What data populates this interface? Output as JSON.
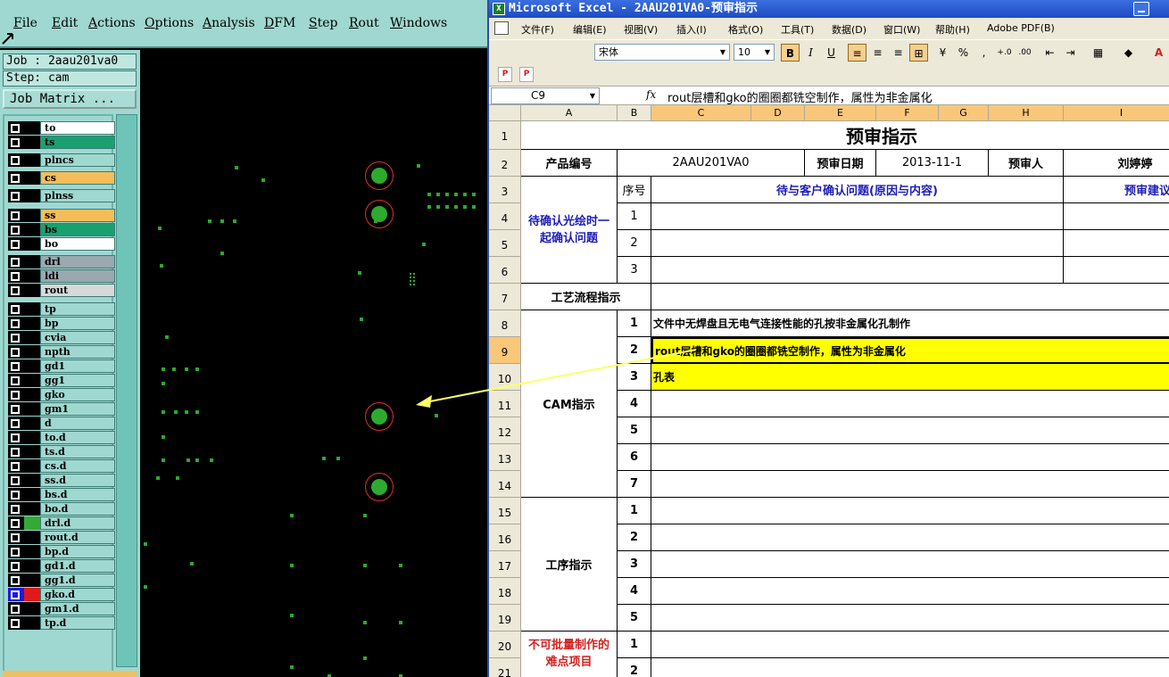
{
  "cam": {
    "menu": [
      "File",
      "Edit",
      "Actions",
      "Options",
      "Analysis",
      "DFM",
      "Step",
      "Rout",
      "Windows"
    ],
    "job_line": "Job : 2aau201va0",
    "step_line": "Step: cam",
    "job_matrix_label": "Job Matrix ...",
    "layers": [
      {
        "name": "to",
        "color": "#ffffff"
      },
      {
        "name": "ts",
        "color": "#1aa06e"
      },
      {
        "name": "plncs",
        "color": "#9fd8d0"
      },
      {
        "name": "cs",
        "color": "#f5bd5a"
      },
      {
        "name": "plnss",
        "color": "#9fd8d0"
      },
      {
        "name": "ss",
        "color": "#f5bd5a"
      },
      {
        "name": "bs",
        "color": "#1aa06e"
      },
      {
        "name": "bo",
        "color": "#ffffff"
      },
      {
        "name": "drl",
        "color": "#9aa8b0"
      },
      {
        "name": "ldi",
        "color": "#9aa8b0"
      },
      {
        "name": "rout",
        "color": "#d8d8d8"
      },
      {
        "name": "tp",
        "color": "#9fd8d0"
      },
      {
        "name": "bp",
        "color": "#9fd8d0"
      },
      {
        "name": "cvia",
        "color": "#9fd8d0"
      },
      {
        "name": "npth",
        "color": "#9fd8d0"
      },
      {
        "name": "gd1",
        "color": "#9fd8d0"
      },
      {
        "name": "gg1",
        "color": "#9fd8d0"
      },
      {
        "name": "gko",
        "color": "#9fd8d0"
      },
      {
        "name": "gm1",
        "color": "#9fd8d0"
      },
      {
        "name": "d",
        "color": "#9fd8d0"
      },
      {
        "name": "to.d",
        "color": "#9fd8d0"
      },
      {
        "name": "ts.d",
        "color": "#9fd8d0"
      },
      {
        "name": "cs.d",
        "color": "#9fd8d0"
      },
      {
        "name": "ss.d",
        "color": "#9fd8d0"
      },
      {
        "name": "bs.d",
        "color": "#9fd8d0"
      },
      {
        "name": "bo.d",
        "color": "#9fd8d0"
      },
      {
        "name": "drl.d",
        "color": "#9fd8d0"
      },
      {
        "name": "rout.d",
        "color": "#9fd8d0"
      },
      {
        "name": "bp.d",
        "color": "#9fd8d0"
      },
      {
        "name": "gd1.d",
        "color": "#9fd8d0"
      },
      {
        "name": "gg1.d",
        "color": "#9fd8d0"
      },
      {
        "name": "gko.d",
        "color": "#9fd8d0"
      },
      {
        "name": "gm1.d",
        "color": "#9fd8d0"
      },
      {
        "name": "tp.d",
        "color": "#9fd8d0"
      }
    ]
  },
  "excel": {
    "title": "Microsoft Excel - 2AAU201VA0-预审指示",
    "menu": [
      "文件(F)",
      "编辑(E)",
      "视图(V)",
      "插入(I)",
      "格式(O)",
      "工具(T)",
      "数据(D)",
      "窗口(W)",
      "帮助(H)",
      "Adobe PDF(B)"
    ],
    "font_name": "宋体",
    "font_size": "10",
    "name_box": "C9",
    "fx": "fx",
    "formula": "rout层槽和gko的圈圈都铣空制作，属性为非金属化",
    "columns": [
      "A",
      "B",
      "C",
      "D",
      "E",
      "F",
      "G",
      "H",
      "I"
    ],
    "rows": [
      "1",
      "2",
      "3",
      "4",
      "5",
      "6",
      "7",
      "8",
      "9",
      "10",
      "11",
      "12",
      "13",
      "14",
      "15",
      "16",
      "17",
      "18",
      "19",
      "20",
      "21"
    ],
    "sheet": {
      "title": "预审指示",
      "product_label": "产品编号",
      "product_value": "2AAU201VA0",
      "date_label": "预审日期",
      "date_value": "2013-11-1",
      "reviewer_label": "预审人",
      "reviewer_value": "刘婷婷",
      "seq_label": "序号",
      "issue_header": "待与客户确认问题(原因与内容)",
      "suggest_header": "预审建议",
      "confirm_section": "待确认光绘时一起确认问题",
      "process_section": "工艺流程指示",
      "cam_section": "CAM指示",
      "procedure_section": "工序指示",
      "difficult_section": "不可批量制作的难点项目",
      "cam_items": [
        "文件中无焊盘且无电气连接性能的孔按非金属化孔制作",
        "rout层槽和gko的圈圈都铣空制作，属性为非金属化",
        "孔表"
      ],
      "nums": [
        "1",
        "2",
        "3",
        "4",
        "5",
        "6",
        "7"
      ]
    }
  }
}
